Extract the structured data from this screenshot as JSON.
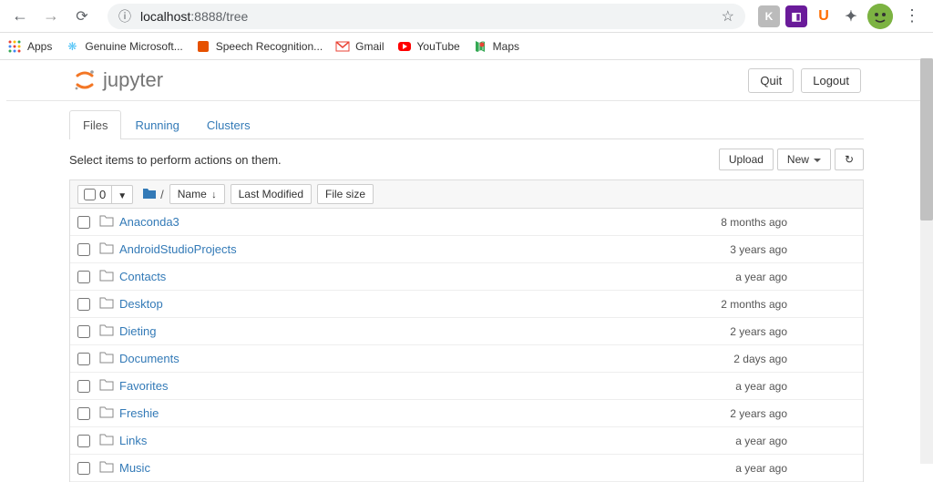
{
  "browser": {
    "url_host": "localhost",
    "url_port_path": ":8888/tree",
    "bookmarks": [
      {
        "icon": "grid",
        "label": "Apps"
      },
      {
        "icon": "cog",
        "label": "Genuine Microsoft..."
      },
      {
        "icon": "mic",
        "label": "Speech Recognition..."
      },
      {
        "icon": "gmail",
        "label": "Gmail"
      },
      {
        "icon": "youtube",
        "label": "YouTube"
      },
      {
        "icon": "maps",
        "label": "Maps"
      }
    ]
  },
  "header": {
    "logo_text": "jupyter",
    "quit": "Quit",
    "logout": "Logout"
  },
  "tabs": {
    "files": "Files",
    "running": "Running",
    "clusters": "Clusters"
  },
  "toolbar": {
    "hint": "Select items to perform actions on them.",
    "upload": "Upload",
    "new": "New"
  },
  "list_header": {
    "select_count": "0",
    "breadcrumb_sep": "/",
    "name": "Name",
    "last_modified": "Last Modified",
    "file_size": "File size"
  },
  "files": [
    {
      "name": "Anaconda3",
      "modified": "8 months ago"
    },
    {
      "name": "AndroidStudioProjects",
      "modified": "3 years ago"
    },
    {
      "name": "Contacts",
      "modified": "a year ago"
    },
    {
      "name": "Desktop",
      "modified": "2 months ago"
    },
    {
      "name": "Dieting",
      "modified": "2 years ago"
    },
    {
      "name": "Documents",
      "modified": "2 days ago"
    },
    {
      "name": "Favorites",
      "modified": "a year ago"
    },
    {
      "name": "Freshie",
      "modified": "2 years ago"
    },
    {
      "name": "Links",
      "modified": "a year ago"
    },
    {
      "name": "Music",
      "modified": "a year ago"
    }
  ]
}
